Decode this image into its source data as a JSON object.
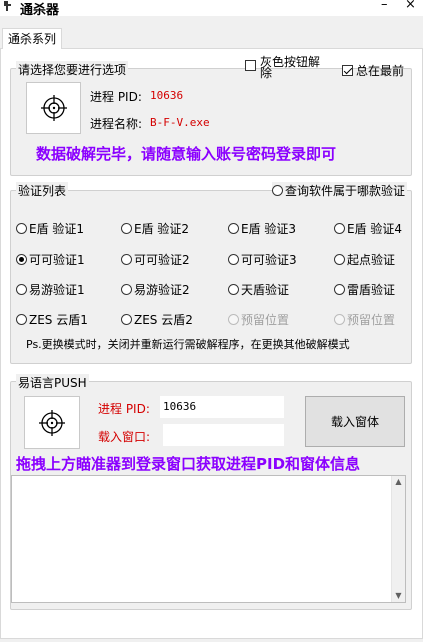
{
  "window": {
    "title": "通杀器",
    "close_glyph": "×",
    "min_glyph": "–"
  },
  "tabs": [
    {
      "label": "通杀系列"
    }
  ],
  "group_select": {
    "title": "请选择您要进行选项",
    "gray_button_checkbox": {
      "label_line1": "灰色按钮解",
      "label_line2": "除",
      "checked": false
    },
    "always_on_top_checkbox": {
      "label": "总在最前",
      "checked": true
    },
    "pid_label": "进程 PID:",
    "pid_value": "10636",
    "process_label": "进程名称:",
    "process_value": "B-F-V.exe",
    "banner": "数据破解完毕，请随意输入账号密码登录即可"
  },
  "group_verify": {
    "title": "验证列表",
    "query_radio": "查询软件属于哪款验证",
    "rows": [
      [
        "E盾 验证1",
        "E盾 验证2",
        "E盾 验证3",
        "E盾 验证4"
      ],
      [
        "可可验证1",
        "可可验证2",
        "可可验证3",
        "起点验证"
      ],
      [
        "易游验证1",
        "易游验证2",
        "天盾验证",
        "雷盾验证"
      ],
      [
        "ZES 云盾1",
        "ZES 云盾2",
        "预留位置",
        "预留位置"
      ]
    ],
    "note": "Ps.更换模式时，关闭并重新运行需破解程序，在更换其他破解模式"
  },
  "group_push": {
    "title": "易语言PUSH",
    "pid_label": "进程 PID:",
    "pid_value": "10636",
    "window_label": "载入窗口:",
    "window_value": "",
    "load_button": "载入窗体",
    "banner": "拖拽上方瞄准器到登录窗口获取进程PID和窗体信息",
    "scroll_up": "▲",
    "scroll_down": "▼"
  },
  "colors": {
    "accent_red": "#d40000",
    "banner_purple": "#8b00ff"
  },
  "icons": [
    "crosshair-icon",
    "app-icon",
    "close-icon",
    "minimize-icon"
  ]
}
